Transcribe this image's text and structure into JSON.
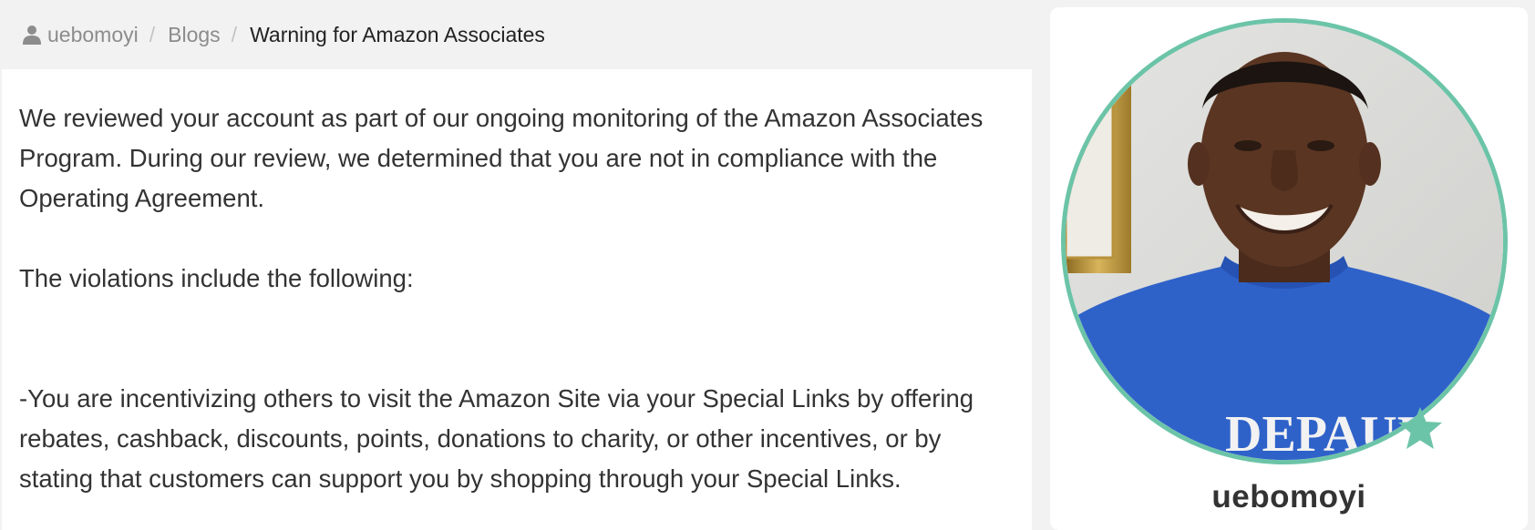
{
  "breadcrumb": {
    "user": "uebomoyi",
    "separator": "/",
    "section": "Blogs",
    "current": "Warning for Amazon Associates"
  },
  "post": {
    "paragraph1": "We reviewed your account as part of our ongoing monitoring of the Amazon Associates Program. During our review, we determined that you are not in compliance with the Operating Agreement.",
    "paragraph2": "The violations include the following:",
    "paragraph3": "-You are incentivizing others to visit the Amazon Site via your Special Links by offering rebates, cashback, discounts, points, donations to charity, or other incentives, or by stating that customers can support you by shopping through your Special Links."
  },
  "profile": {
    "username": "uebomoyi",
    "shirt_text": "DEPAUL"
  },
  "colors": {
    "avatar_ring": "#6cc4a8",
    "star": "#6cc4a8",
    "shirt": "#2f62c9"
  }
}
